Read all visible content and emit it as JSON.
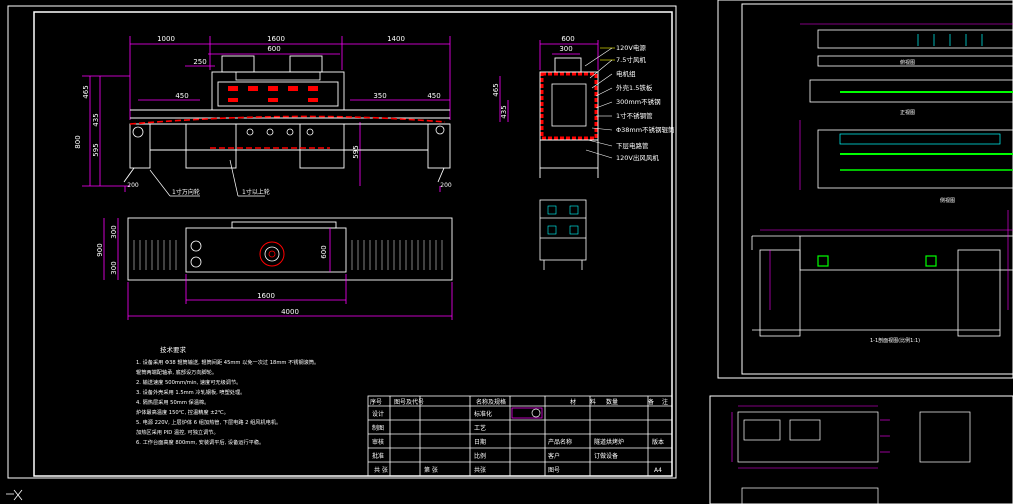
{
  "drawing": {
    "dims_top": [
      "1000",
      "1600",
      "1400"
    ],
    "dims_sub": [
      "600",
      "250",
      "450",
      "350",
      "450"
    ],
    "dims_left": [
      "465",
      "435",
      "800",
      "595"
    ],
    "dims_right": [
      "595"
    ],
    "dims_bottom": [
      "200",
      "200"
    ],
    "leader_labels": [
      "1寸万向轮",
      "1寸以上轮"
    ],
    "side_dims_top": [
      "600",
      "300"
    ],
    "side_dims_left": [
      "465",
      "435"
    ],
    "side_labels": [
      "120V电源",
      "7.5寸风机",
      "电机组",
      "外壳1.5铁板",
      "300mm不锈钢",
      "1寸不锈钢管",
      "Φ38mm不锈钢辊筒",
      "下层电路管",
      "120V出风风机"
    ],
    "plan_dims_left": [
      "300",
      "900",
      "300"
    ],
    "plan_dims_right": [
      "600"
    ],
    "plan_dims_bottom": [
      "1600",
      "4000"
    ],
    "notes_title": "技术要求",
    "notes": [
      "1. 设备采用 Φ38 辊筒输送, 辊筒间距 45mm 以免一次过 18mm 不锈钢滚筒。",
      "   辊筒两端配轴承, 底部设万向脚轮。",
      "2. 输送速度 500mm/min, 速度可无级调节。",
      "3. 设备外壳采用 1.5mm 冷轧钢板, 喷塑处理。",
      "4. 隔热层采用 50mm 保温棉。",
      "   炉体最高温度 150℃, 控温精度 ±2℃。",
      "5. 电源 220V, 上层炉体 6 组加热管, 下层电路 2 组风机电机。",
      "   加热区采用 PID 温控, 可独立调节。",
      "6. 工作台面高度 800mm, 安装调平后, 设备运行平稳。"
    ],
    "title_block": {
      "header": [
        "序号",
        "图号及代号",
        "名称及规格",
        "材",
        "料",
        "数量",
        "备",
        "注"
      ],
      "rows": [
        "设计",
        "制图",
        "审核",
        "批准"
      ],
      "mid_labels": [
        "标准化",
        "工艺",
        "日期",
        "比例",
        "共张"
      ],
      "product_label": "产品名称",
      "product_name": "隧道烘烤炉",
      "customer_label": "客户",
      "customer_name": "订做设备",
      "drawing_no_label": "图号",
      "edition_label": "版本",
      "sheet": "A4",
      "footer": [
        "共 张",
        "第 张"
      ]
    }
  },
  "right_panel": {
    "section_labels": [
      "俯视图",
      "正视图",
      "侧视图",
      "1-1剖面视图(比例1:1)"
    ]
  },
  "colors": {
    "background": "#000000",
    "frame": "#ffffff",
    "dimension": "#ff00ff",
    "body": "#ffffff",
    "heating": "#ff0000",
    "accent": "#00ff00",
    "cyan": "#00ffff"
  }
}
